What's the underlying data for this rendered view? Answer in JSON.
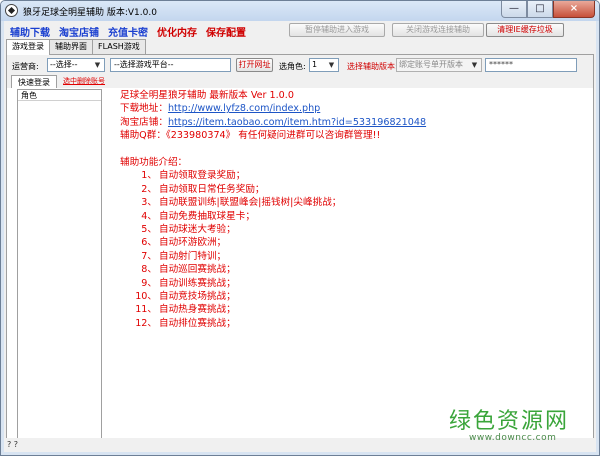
{
  "window": {
    "title": "狼牙足球全明星辅助 版本:V1.0.0",
    "min": "—",
    "max": "□",
    "close": "×"
  },
  "topmenu": {
    "items": [
      {
        "label": "辅助下载",
        "color": "#1a3fd0"
      },
      {
        "label": "淘宝店铺",
        "color": "#1a3fd0"
      },
      {
        "label": "充值卡密",
        "color": "#1a3fd0"
      },
      {
        "label": "优化内存",
        "color": "#d00000"
      },
      {
        "label": "保存配置",
        "color": "#d00000"
      }
    ],
    "pause_button": "暂停辅助进入游戏",
    "close_button": "关闭游戏连接辅助",
    "clear_button": "清理IE缓存垃圾"
  },
  "tabs": [
    "游戏登录",
    "辅助界面",
    "FLASH游戏"
  ],
  "controls": {
    "operator_label": "运营商:",
    "operator_value": "--选择--",
    "platform_value": "--选择游戏平台--",
    "open_button": "打开网址",
    "role_label": "选角色:",
    "role_value": "1",
    "version_label": "选择辅助版本:",
    "account_placeholder": "绑定账号单开版本",
    "password_value": "******"
  },
  "subtabs": {
    "quick_login": "快速登录",
    "double_click": "选中删除账号"
  },
  "list": {
    "header": "角色"
  },
  "content": {
    "heading": "足球全明星狼牙辅助  最新版本 Ver 1.0.0",
    "download_label": "下载地址：",
    "download_url": "http://www.lyfz8.com/index.php",
    "shop_label": "淘宝店铺：",
    "shop_url": "https://item.taobao.com/item.htm?id=533196821048",
    "qq_line": "辅助Q群：《233980374》 有任何疑问进群可以咨询群管理!!",
    "intro": "辅助功能介绍：",
    "features": [
      {
        "num": "1、",
        "text": "自动领取登录奖励；"
      },
      {
        "num": "2、",
        "text": "自动领取日常任务奖励；"
      },
      {
        "num": "3、",
        "text": "自动联盟训练|联盟峰会|摇钱树|尖峰挑战；"
      },
      {
        "num": "4、",
        "text": "自动免费抽取球星卡；"
      },
      {
        "num": "5、",
        "text": "自动球迷大考验；"
      },
      {
        "num": "6、",
        "text": "自动环游欧洲；"
      },
      {
        "num": "7、",
        "text": "自动射门特训；"
      },
      {
        "num": "8、",
        "text": "自动巡回赛挑战；"
      },
      {
        "num": "9、",
        "text": "自动训练赛挑战；"
      },
      {
        "num": "10、",
        "text": "自动竞技场挑战；"
      },
      {
        "num": "11、",
        "text": "自动热身赛挑战；"
      },
      {
        "num": "12、",
        "text": "自动排位赛挑战；"
      }
    ]
  },
  "watermark": {
    "logo": "绿色资源网",
    "url": "www.downcc.com"
  },
  "status": {
    "text": "? ?"
  }
}
